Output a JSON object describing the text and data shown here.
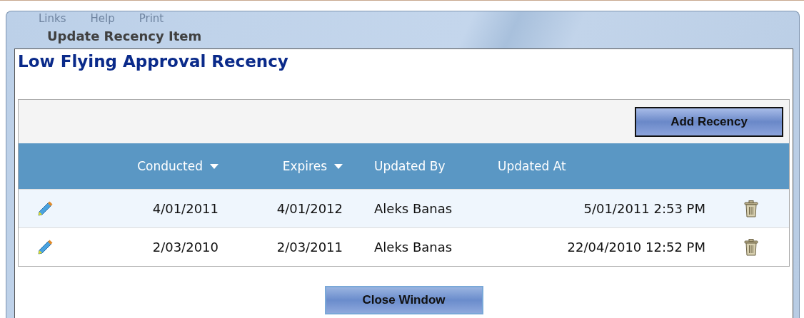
{
  "background_menu": [
    "Links",
    "Help",
    "Print"
  ],
  "window": {
    "title": "Update Recency Item"
  },
  "heading": "Low Flying Approval Recency",
  "toolbar": {
    "add_button": "Add Recency"
  },
  "table": {
    "columns": [
      {
        "label": "Conducted",
        "sortable": true
      },
      {
        "label": "Expires",
        "sortable": true
      },
      {
        "label": "Updated By",
        "sortable": false
      },
      {
        "label": "Updated At",
        "sortable": false
      }
    ],
    "rows": [
      {
        "cells": [
          "4/01/2011",
          "4/01/2012",
          "Aleks Banas",
          "5/01/2011 2:53 PM"
        ]
      },
      {
        "cells": [
          "2/03/2010",
          "2/03/2011",
          "Aleks Banas",
          "22/04/2010 12:52 PM"
        ]
      }
    ]
  },
  "close_button": "Close Window"
}
